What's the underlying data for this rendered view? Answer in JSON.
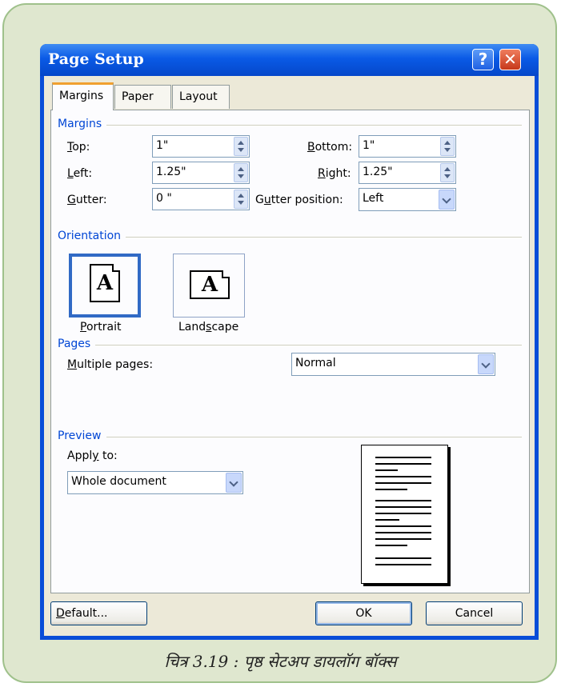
{
  "window": {
    "title": "Page Setup",
    "help_glyph": "?",
    "close_glyph": "✕"
  },
  "tabs": [
    {
      "label": "Margins",
      "active": true
    },
    {
      "label": "Paper"
    },
    {
      "label": "Layout"
    }
  ],
  "margins": {
    "group_label": "Margins",
    "top": {
      "label_u": "T",
      "label_rest": "op:",
      "value": "1\""
    },
    "left": {
      "label_u": "L",
      "label_rest": "eft:",
      "value": "1.25\""
    },
    "gutter": {
      "label_u": "G",
      "label_rest": "utter:",
      "value": "0 \""
    },
    "bottom": {
      "label_u": "B",
      "label_rest": "ottom:",
      "value": "1\""
    },
    "right": {
      "label_u": "R",
      "label_rest": "ight:",
      "value": "1.25\""
    },
    "gutter_position": {
      "label_pre": "G",
      "label_u": "u",
      "label_rest": "tter position:",
      "value": "Left"
    }
  },
  "orientation": {
    "group_label": "Orientation",
    "portrait": {
      "label_u": "P",
      "label_rest": "ortrait",
      "glyph": "A",
      "selected": true
    },
    "landscape": {
      "label_pre": "Land",
      "label_u": "s",
      "label_rest": "cape",
      "glyph": "A"
    }
  },
  "pages": {
    "group_label": "Pages",
    "multiple_label_u": "M",
    "multiple_label_rest": "ultiple pages:",
    "multiple_value": "Normal"
  },
  "preview": {
    "group_label": "Preview",
    "apply_pre": "Appl",
    "apply_u": "y",
    "apply_rest": " to:",
    "apply_value": "Whole document"
  },
  "buttons": {
    "default_u": "D",
    "default_rest": "efault...",
    "ok": "OK",
    "cancel": "Cancel"
  },
  "caption": "चित्र 3.19 : पृष्ठ सेटअप डायलॉग बॉक्स",
  "colors": {
    "titlebar": "#0a5ae6",
    "group_label": "#0046d5",
    "frame_bg": "#dfe7cf",
    "active_tab": "#f0a030"
  }
}
